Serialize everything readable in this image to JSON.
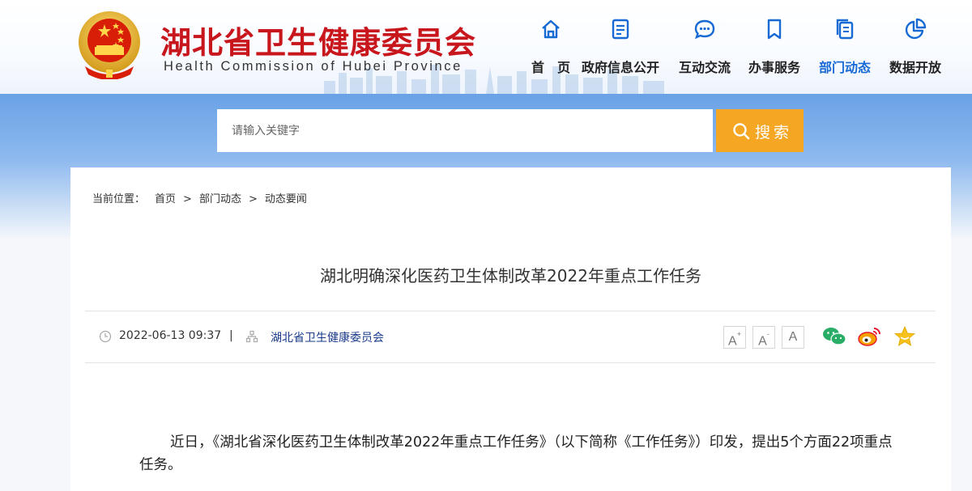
{
  "header": {
    "title": "湖北省卫生健康委员会",
    "subtitle": "Health Commission of Hubei Province",
    "emblem_icon": "national-emblem-icon",
    "brand_color": "#c8161d"
  },
  "nav": {
    "active_color": "#1769d4",
    "items": [
      {
        "label": "首　页",
        "icon": "home-icon"
      },
      {
        "label": "政府信息公开",
        "icon": "document-list-icon"
      },
      {
        "label": "互动交流",
        "icon": "chat-bubble-icon"
      },
      {
        "label": "办事服务",
        "icon": "bookmark-icon"
      },
      {
        "label": "部门动态",
        "icon": "pages-icon",
        "active": true
      },
      {
        "label": "数据开放",
        "icon": "pie-chart-icon"
      }
    ]
  },
  "search": {
    "placeholder": "请输入关键字",
    "button_label": "搜索",
    "button_color": "#f5a623"
  },
  "breadcrumb": {
    "prefix": "当前位置：",
    "items": [
      "首页",
      "部门动态",
      "动态要闻"
    ],
    "separator": ">"
  },
  "article": {
    "title": "湖北明确深化医药卫生体制改革2022年重点工作任务",
    "date": "2022-06-13 09:37",
    "separator": "|",
    "source": "湖北省卫生健康委员会",
    "font_controls": [
      "A+",
      "A-",
      "A"
    ],
    "share": [
      "wechat-icon",
      "weibo-icon",
      "favorite-star-icon"
    ],
    "body": "近日，《湖北省深化医药卫生体制改革2022年重点工作任务》（以下简称《工作任务》）印发，提出5个方面22项重点任务。"
  }
}
